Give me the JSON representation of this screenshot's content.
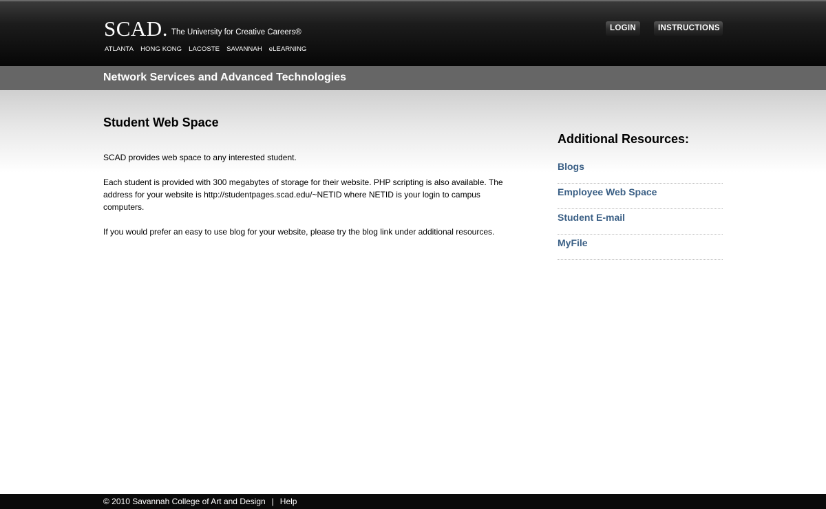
{
  "header": {
    "logo_text": "SCAD.",
    "tagline": "The University for Creative Careers®",
    "locations": [
      "ATLANTA",
      "HONG KONG",
      "LACOSTE",
      "SAVANNAH",
      "eLEARNING"
    ],
    "login_label": "LOGIN",
    "instructions_label": "INSTRUCTIONS"
  },
  "section": {
    "title": "Network Services and Advanced Technologies"
  },
  "main": {
    "heading": "Student Web Space",
    "paragraphs": [
      "SCAD provides web space to any interested student.",
      "Each student is provided with 300 megabytes of storage for their website. PHP scripting is also available. The address for your website is http://studentpages.scad.edu/~NETID where NETID is your login to campus computers.",
      "If you would prefer an easy to use blog for your website, please try the blog link under additional resources."
    ]
  },
  "sidebar": {
    "heading": "Additional Resources:",
    "links": [
      "Blogs",
      "Employee Web Space",
      "Student E-mail",
      "MyFile"
    ]
  },
  "footer": {
    "copyright": "© 2010 Savannah College of Art and Design",
    "separator": "|",
    "help_label": "Help"
  },
  "colors": {
    "link": "#3a5f85",
    "section_bar": "#666666",
    "header_bg": "#111111",
    "footer_bg": "#0a0a0a"
  }
}
